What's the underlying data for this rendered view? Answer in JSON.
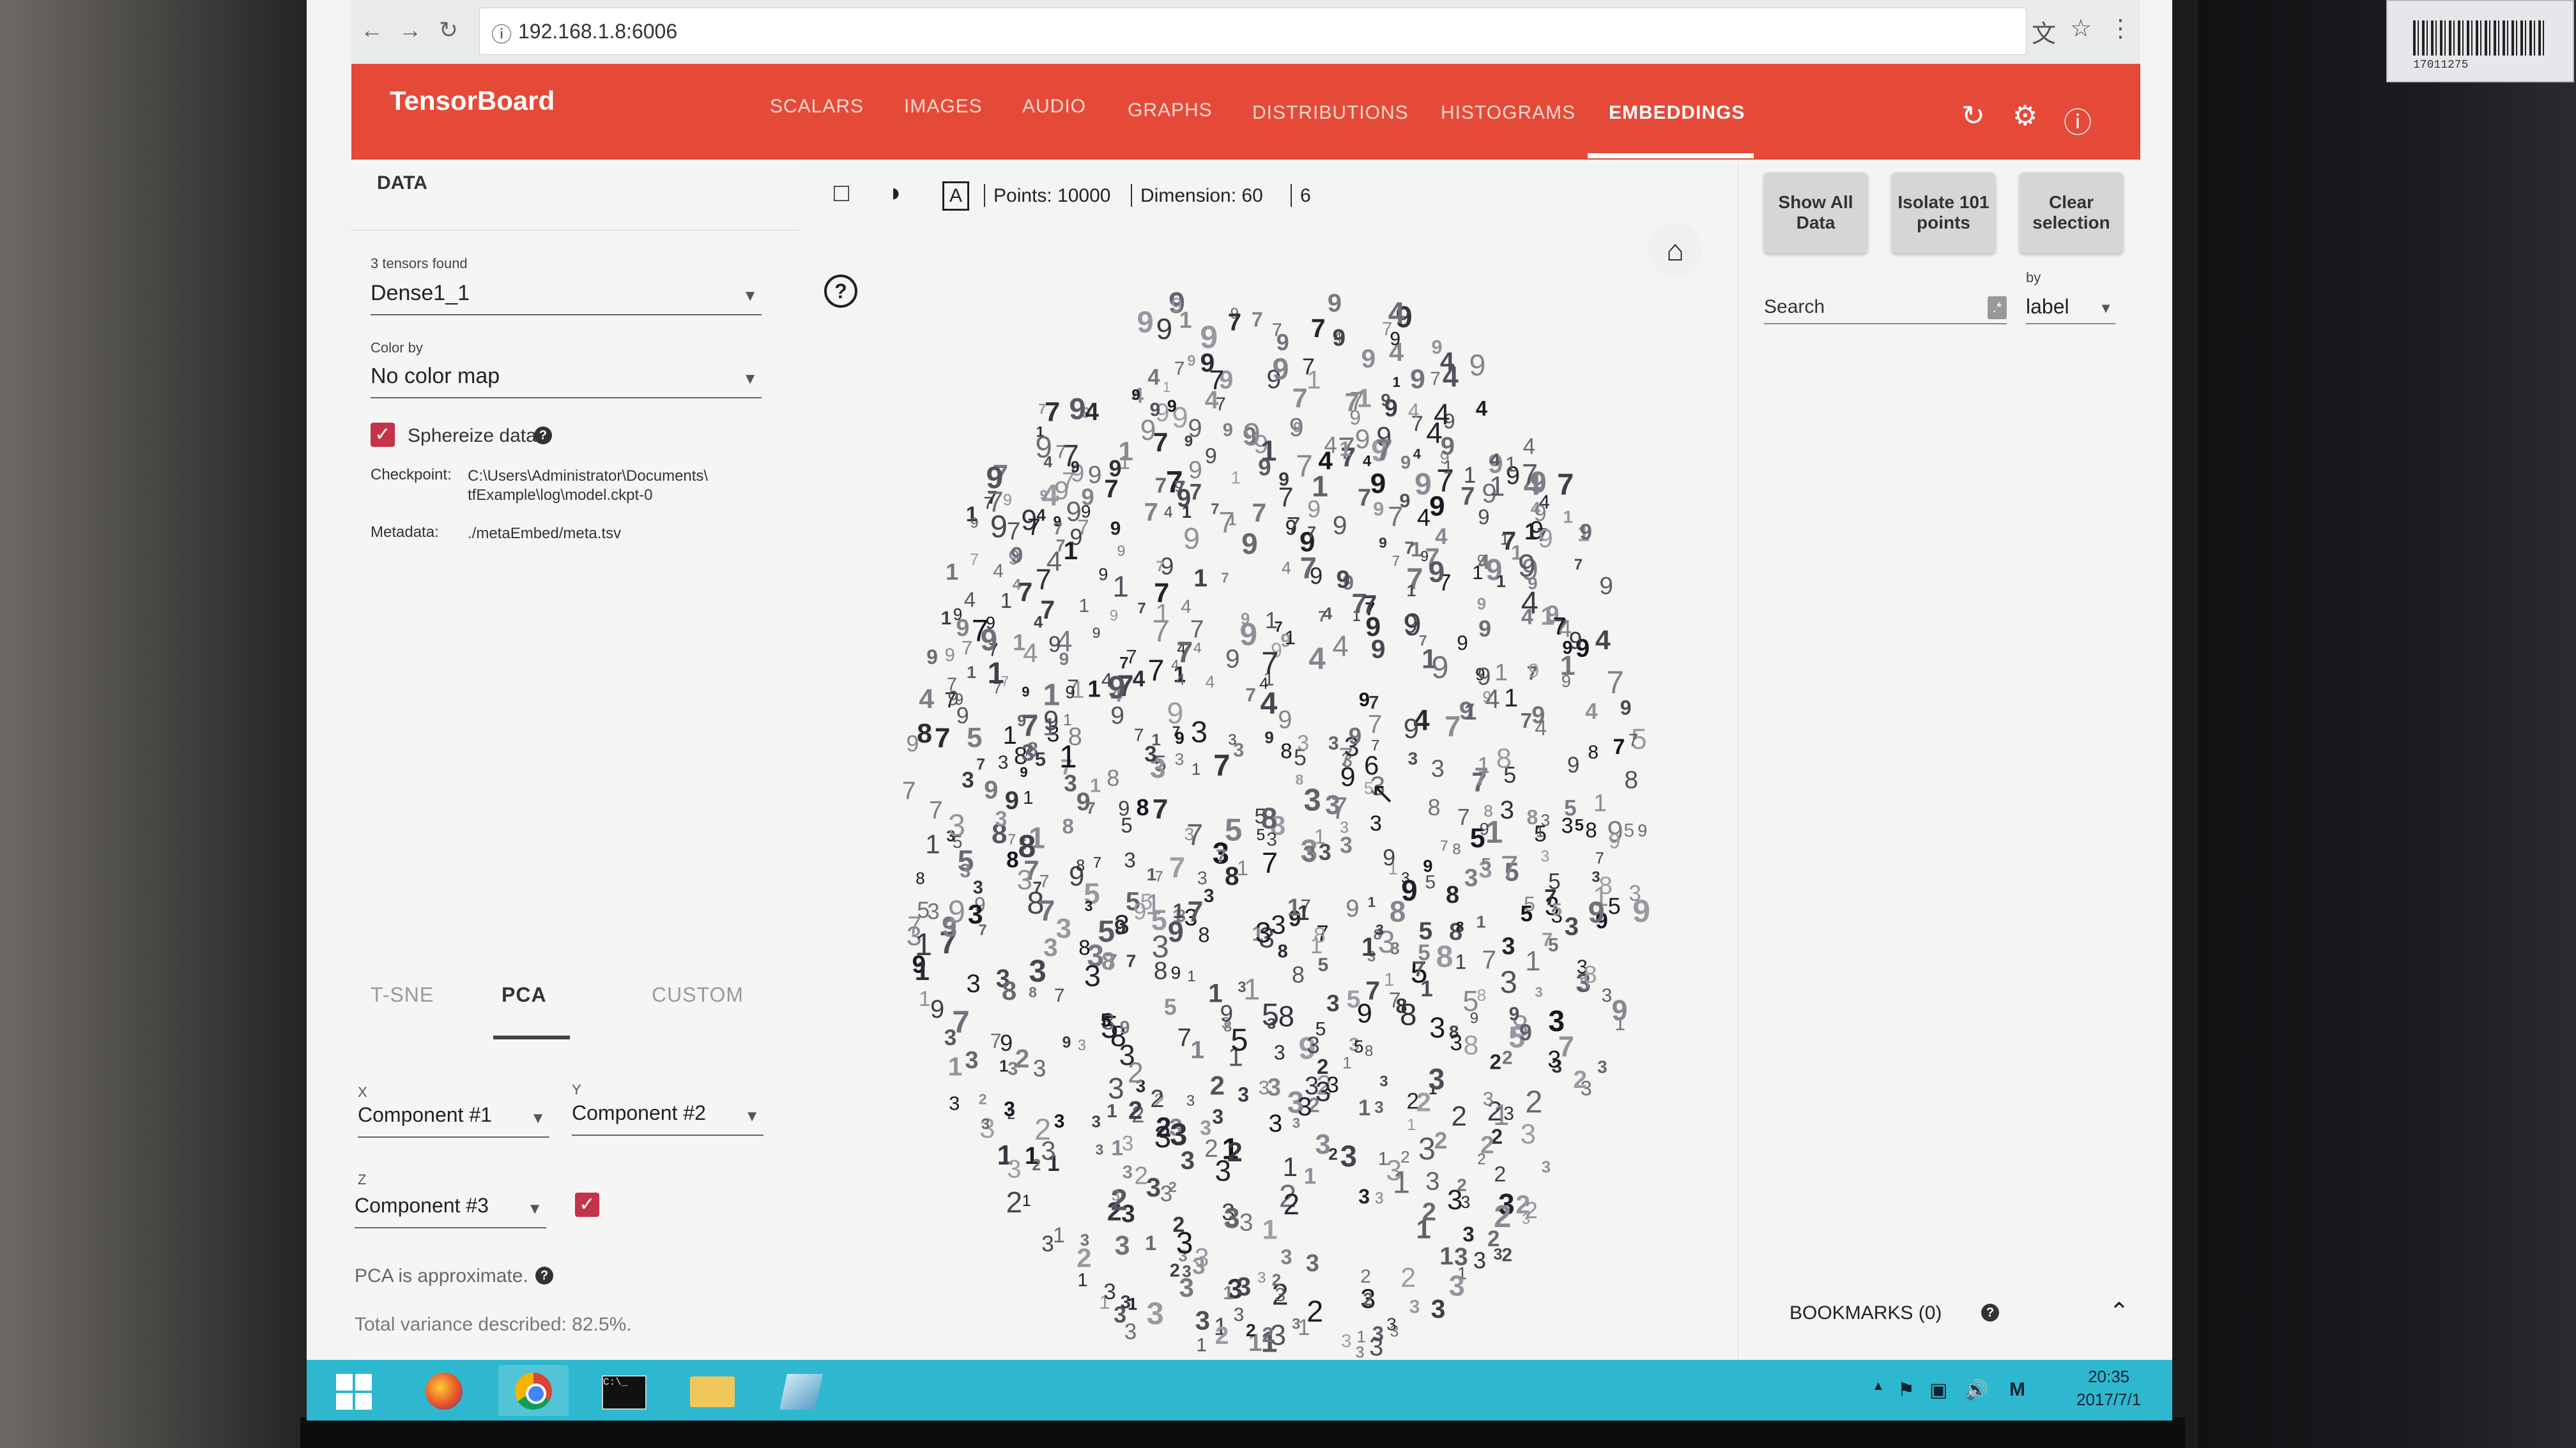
{
  "browser": {
    "url": "192.168.1.8:6006"
  },
  "header": {
    "title": "TensorBoard",
    "tabs": [
      "SCALARS",
      "IMAGES",
      "AUDIO",
      "GRAPHS",
      "DISTRIBUTIONS",
      "HISTOGRAMS",
      "EMBEDDINGS"
    ],
    "active_tab": "EMBEDDINGS",
    "color": "#e54a38"
  },
  "data_panel": {
    "title": "DATA",
    "tensors_found": "3 tensors found",
    "tensor": "Dense1_1",
    "color_by_label": "Color by",
    "color_by": "No color map",
    "sphereize_label": "Sphereize data",
    "sphereize_checked": true,
    "checkpoint_label": "Checkpoint:",
    "checkpoint_line1": "C:\\Users\\Administrator\\Documents\\",
    "checkpoint_line2": "tfExample\\log\\model.ckpt-0",
    "metadata_label": "Metadata:",
    "metadata": "./metaEmbed/meta.tsv"
  },
  "projection": {
    "tabs": [
      "T-SNE",
      "PCA",
      "CUSTOM"
    ],
    "active": "PCA",
    "x_label": "X",
    "x": "Component #1",
    "y_label": "Y",
    "y": "Component #2",
    "z_label": "Z",
    "z": "Component #3",
    "z_enabled": true,
    "approx": "PCA is approximate.",
    "variance": "Total variance described: 82.5%."
  },
  "toolbar": {
    "points": "Points: 10000",
    "dimension": "Dimension: 60",
    "selected": "6",
    "hover_label": "6"
  },
  "inspector": {
    "show_all": "Show All Data",
    "isolate": "Isolate 101 points",
    "clear": "Clear selection",
    "search_placeholder": "Search",
    "regex_symbol": ".*",
    "by_label": "by",
    "by_value": "label",
    "bookmarks": "BOOKMARKS (0)"
  },
  "taskbar": {
    "time": "20:35",
    "date": "2017/7/1",
    "ime": "M"
  },
  "sticker": {
    "number": "17011275"
  }
}
